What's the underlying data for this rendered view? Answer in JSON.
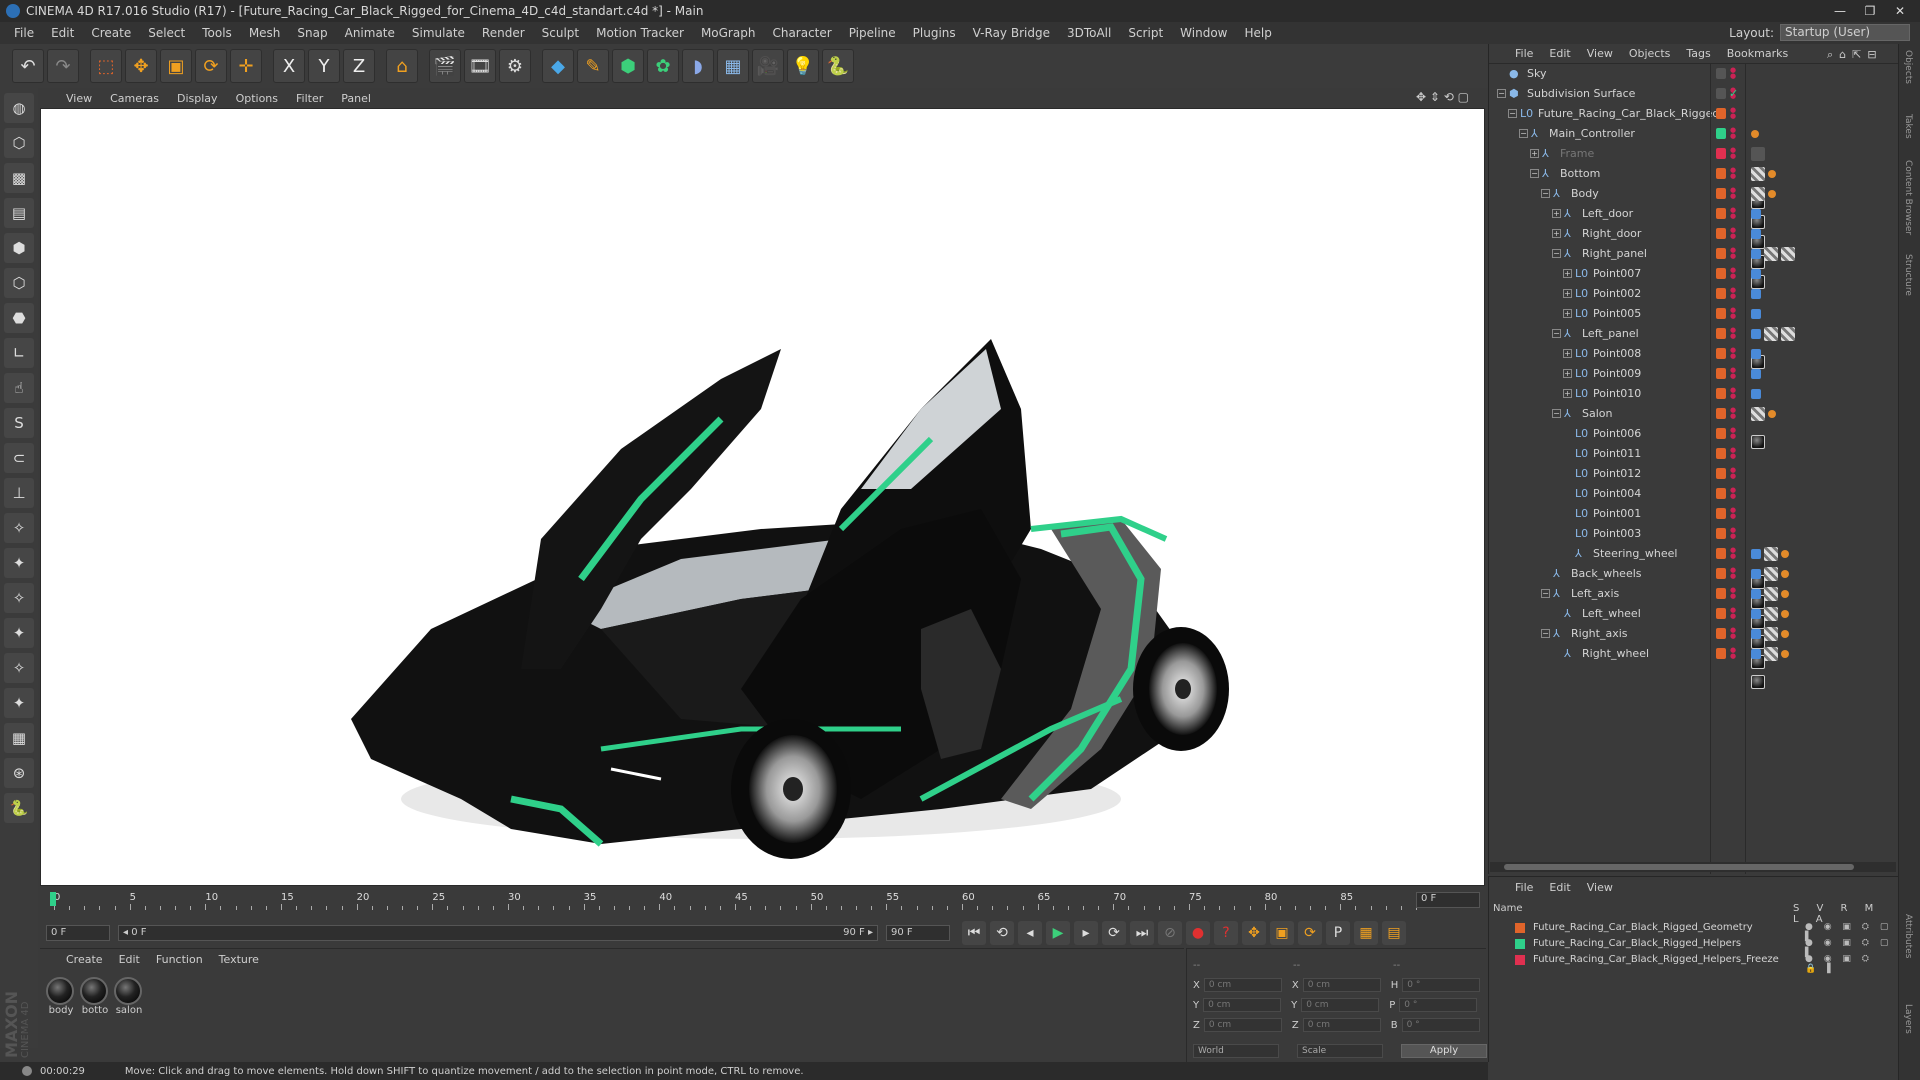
{
  "titlebar": {
    "title": "CINEMA 4D R17.016 Studio (R17) - [Future_Racing_Car_Black_Rigged_for_Cinema_4D_c4d_standart.c4d *] - Main",
    "minimize": "—",
    "restore": "❐",
    "close": "✕"
  },
  "menubar": {
    "items": [
      "File",
      "Edit",
      "Create",
      "Select",
      "Tools",
      "Mesh",
      "Snap",
      "Animate",
      "Simulate",
      "Render",
      "Sculpt",
      "Motion Tracker",
      "MoGraph",
      "Character",
      "Pipeline",
      "Plugins",
      "V-Ray Bridge",
      "3DToAll",
      "Script",
      "Window",
      "Help"
    ],
    "layout_label": "Layout:",
    "layout_value": "Startup (User)"
  },
  "toolbar": {
    "tools": [
      {
        "name": "undo-icon",
        "glyph": "↶",
        "color": "#dddddd"
      },
      {
        "name": "redo-icon",
        "glyph": "↷",
        "color": "#888888"
      },
      {
        "name": "live-select-icon",
        "glyph": "⬚",
        "color": "#e0642a"
      },
      {
        "name": "move-icon",
        "glyph": "✥",
        "color": "#f0a020"
      },
      {
        "name": "scale-icon",
        "glyph": "▣",
        "color": "#f0a020"
      },
      {
        "name": "rotate-icon",
        "glyph": "⟳",
        "color": "#f0a020"
      },
      {
        "name": "transform-icon",
        "glyph": "✛",
        "color": "#f0a020"
      },
      {
        "name": "x-axis-icon",
        "glyph": "X",
        "color": "#eeeeee"
      },
      {
        "name": "y-axis-icon",
        "glyph": "Y",
        "color": "#eeeeee"
      },
      {
        "name": "z-axis-icon",
        "glyph": "Z",
        "color": "#eeeeee"
      },
      {
        "name": "world-coords-icon",
        "glyph": "⌂",
        "color": "#f0a020"
      },
      {
        "name": "render-view-icon",
        "glyph": "🎬",
        "color": "#dddddd"
      },
      {
        "name": "render-picture-icon",
        "glyph": "🎞",
        "color": "#dddddd"
      },
      {
        "name": "render-settings-icon",
        "glyph": "⚙",
        "color": "#dddddd"
      },
      {
        "name": "cube-icon",
        "glyph": "◆",
        "color": "#4aa8e8"
      },
      {
        "name": "pen-icon",
        "glyph": "✎",
        "color": "#f0a020"
      },
      {
        "name": "subdivision-icon",
        "glyph": "⬢",
        "color": "#3ccf7a"
      },
      {
        "name": "cloner-icon",
        "glyph": "✿",
        "color": "#3ccf7a"
      },
      {
        "name": "deformer-icon",
        "glyph": "◗",
        "color": "#8aa8e8"
      },
      {
        "name": "floor-icon",
        "glyph": "▦",
        "color": "#8ab8e8"
      },
      {
        "name": "camera-icon",
        "glyph": "🎥",
        "color": "#dddddd"
      },
      {
        "name": "light-icon",
        "glyph": "💡",
        "color": "#dddddd"
      },
      {
        "name": "python-icon",
        "glyph": "🐍",
        "color": "#4a8ad8"
      }
    ]
  },
  "lefttools": [
    {
      "name": "sculpt-mode-icon",
      "glyph": "◍"
    },
    {
      "name": "model-mode-icon",
      "glyph": "⬡"
    },
    {
      "name": "texture-mode-icon",
      "glyph": "▩"
    },
    {
      "name": "workplane-icon",
      "glyph": "▤"
    },
    {
      "name": "points-mode-icon",
      "glyph": "⬢"
    },
    {
      "name": "edges-mode-icon",
      "glyph": "⬡"
    },
    {
      "name": "polygons-mode-icon",
      "glyph": "⬣"
    },
    {
      "name": "axis-mode-icon",
      "glyph": "∟"
    },
    {
      "name": "tweak-icon",
      "glyph": "☝"
    },
    {
      "name": "snap-icon",
      "glyph": "S"
    },
    {
      "name": "magnet-icon",
      "glyph": "⊂"
    },
    {
      "name": "axis-lock-icon",
      "glyph": "⊥"
    },
    {
      "name": "brush-1-icon",
      "glyph": "✧"
    },
    {
      "name": "brush-2-icon",
      "glyph": "✦"
    },
    {
      "name": "brush-3-icon",
      "glyph": "✧"
    },
    {
      "name": "brush-4-icon",
      "glyph": "✦"
    },
    {
      "name": "brush-5-icon",
      "glyph": "✧"
    },
    {
      "name": "brush-6-icon",
      "glyph": "✦"
    },
    {
      "name": "grid-lock-icon",
      "glyph": "▦"
    },
    {
      "name": "workplane-lock-icon",
      "glyph": "⊛"
    },
    {
      "name": "python-icon",
      "glyph": "🐍"
    }
  ],
  "viewport": {
    "menu": [
      "View",
      "Cameras",
      "Display",
      "Options",
      "Filter",
      "Panel"
    ],
    "nav_icons": "✥ ⇕ ⟲ ▢"
  },
  "timeline": {
    "ticks": [
      "0",
      "5",
      "10",
      "15",
      "20",
      "25",
      "30",
      "35",
      "40",
      "45",
      "50",
      "55",
      "60",
      "65",
      "70",
      "75",
      "80",
      "85",
      "90"
    ],
    "current_frame": "0 F",
    "start_field": "0 F",
    "range_start": "◂ 0 F",
    "range_end": "90 F ▸",
    "end_field": "90 F"
  },
  "transport": {
    "buttons": [
      {
        "name": "goto-start-icon",
        "glyph": "⏮",
        "color": "#dddddd"
      },
      {
        "name": "prev-key-icon",
        "glyph": "⟲",
        "color": "#dddddd"
      },
      {
        "name": "prev-frame-icon",
        "glyph": "◂",
        "color": "#dddddd"
      },
      {
        "name": "play-icon",
        "glyph": "▶",
        "color": "#3ccf7a"
      },
      {
        "name": "next-frame-icon",
        "glyph": "▸",
        "color": "#dddddd"
      },
      {
        "name": "next-key-icon",
        "glyph": "⟳",
        "color": "#dddddd"
      },
      {
        "name": "goto-end-icon",
        "glyph": "⏭",
        "color": "#dddddd"
      },
      {
        "name": "record-disabled-icon",
        "glyph": "⊘",
        "color": "#777777"
      },
      {
        "name": "record-keys-icon",
        "glyph": "●",
        "color": "#e03030"
      },
      {
        "name": "auto-key-icon",
        "glyph": "?",
        "color": "#e03030"
      },
      {
        "name": "key-pos-icon",
        "glyph": "✥",
        "color": "#f0a020"
      },
      {
        "name": "key-scale-icon",
        "glyph": "▣",
        "color": "#f0a020"
      },
      {
        "name": "key-rot-icon",
        "glyph": "⟳",
        "color": "#f0a020"
      },
      {
        "name": "key-param-icon",
        "glyph": "P",
        "color": "#dddddd"
      },
      {
        "name": "key-pla-icon",
        "glyph": "▦",
        "color": "#f0a020"
      },
      {
        "name": "timeline-icon",
        "glyph": "▤",
        "color": "#f0a020"
      }
    ]
  },
  "materials": {
    "menu": [
      "Create",
      "Edit",
      "Function",
      "Texture"
    ],
    "items": [
      "body",
      "botto",
      "salon"
    ]
  },
  "coordinates": {
    "rows": [
      {
        "a": "X",
        "av": "0 cm",
        "b": "X",
        "bv": "0 cm",
        "c": "H",
        "cv": "0 °"
      },
      {
        "a": "Y",
        "av": "0 cm",
        "b": "Y",
        "bv": "0 cm",
        "c": "P",
        "cv": "0 °"
      },
      {
        "a": "Z",
        "av": "0 cm",
        "b": "Z",
        "bv": "0 cm",
        "c": "B",
        "cv": "0 °"
      }
    ],
    "header_left": "--",
    "header_mid": "--",
    "header_right": "--",
    "mode_world": "World",
    "mode_scale": "Scale",
    "apply": "Apply"
  },
  "statusbar": {
    "time": "00:00:29",
    "message": "Move: Click and drag to move elements. Hold down SHIFT to quantize movement / add to the selection in point mode, CTRL to remove."
  },
  "brand": {
    "maxon": "MAXON",
    "cinema": "CINEMA 4D"
  },
  "objects": {
    "menu": [
      "File",
      "Edit",
      "View",
      "Objects",
      "Tags",
      "Bookmarks"
    ],
    "rows": [
      {
        "label": "Sky",
        "indent": 0,
        "exp": "",
        "icon": "●",
        "swatch": "#555555",
        "tags": ""
      },
      {
        "label": "Subdivision Surface",
        "indent": 0,
        "exp": "−",
        "icon": "⬢",
        "swatch": "#555555",
        "tags": "✓"
      },
      {
        "label": "Future_Racing_Car_Black_Rigged",
        "indent": 1,
        "exp": "−",
        "icon": "L0",
        "swatch": "#e0642a",
        "tags": ""
      },
      {
        "label": "Main_Controller",
        "indent": 2,
        "exp": "−",
        "icon": "⅄",
        "swatch": "#2fd08a",
        "tags": "o"
      },
      {
        "label": "Frame",
        "indent": 3,
        "exp": "+",
        "icon": "⅄",
        "swatch": "#e03050",
        "tags": "g"
      },
      {
        "label": "Bottom",
        "indent": 3,
        "exp": "−",
        "icon": "⅄",
        "swatch": "#e0642a",
        "tags": "mco"
      },
      {
        "label": "Body",
        "indent": 4,
        "exp": "−",
        "icon": "⅄",
        "swatch": "#e0642a",
        "tags": "mco"
      },
      {
        "label": "Left_door",
        "indent": 5,
        "exp": "+",
        "icon": "⅄",
        "swatch": "#e0642a",
        "tags": "bm"
      },
      {
        "label": "Right_door",
        "indent": 5,
        "exp": "+",
        "icon": "⅄",
        "swatch": "#e0642a",
        "tags": "bm"
      },
      {
        "label": "Right_panel",
        "indent": 5,
        "exp": "−",
        "icon": "⅄",
        "swatch": "#e0642a",
        "tags": "bmcc"
      },
      {
        "label": "Point007",
        "indent": 6,
        "exp": "+",
        "icon": "L0",
        "swatch": "#e0642a",
        "tags": "v"
      },
      {
        "label": "Point002",
        "indent": 6,
        "exp": "+",
        "icon": "L0",
        "swatch": "#e0642a",
        "tags": "v"
      },
      {
        "label": "Point005",
        "indent": 6,
        "exp": "+",
        "icon": "L0",
        "swatch": "#e0642a",
        "tags": "v"
      },
      {
        "label": "Left_panel",
        "indent": 5,
        "exp": "−",
        "icon": "⅄",
        "swatch": "#e0642a",
        "tags": "bmcc"
      },
      {
        "label": "Point008",
        "indent": 6,
        "exp": "+",
        "icon": "L0",
        "swatch": "#e0642a",
        "tags": "v"
      },
      {
        "label": "Point009",
        "indent": 6,
        "exp": "+",
        "icon": "L0",
        "swatch": "#e0642a",
        "tags": "v"
      },
      {
        "label": "Point010",
        "indent": 6,
        "exp": "+",
        "icon": "L0",
        "swatch": "#e0642a",
        "tags": "v"
      },
      {
        "label": "Salon",
        "indent": 5,
        "exp": "−",
        "icon": "⅄",
        "swatch": "#e0642a",
        "tags": "mco"
      },
      {
        "label": "Point006",
        "indent": 6,
        "exp": "",
        "icon": "L0",
        "swatch": "#e0642a",
        "tags": ""
      },
      {
        "label": "Point011",
        "indent": 6,
        "exp": "",
        "icon": "L0",
        "swatch": "#e0642a",
        "tags": ""
      },
      {
        "label": "Point012",
        "indent": 6,
        "exp": "",
        "icon": "L0",
        "swatch": "#e0642a",
        "tags": ""
      },
      {
        "label": "Point004",
        "indent": 6,
        "exp": "",
        "icon": "L0",
        "swatch": "#e0642a",
        "tags": ""
      },
      {
        "label": "Point001",
        "indent": 6,
        "exp": "",
        "icon": "L0",
        "swatch": "#e0642a",
        "tags": ""
      },
      {
        "label": "Point003",
        "indent": 6,
        "exp": "",
        "icon": "L0",
        "swatch": "#e0642a",
        "tags": ""
      },
      {
        "label": "Steering_wheel",
        "indent": 6,
        "exp": "",
        "icon": "⅄",
        "swatch": "#e0642a",
        "tags": "bmco"
      },
      {
        "label": "Back_wheels",
        "indent": 4,
        "exp": "",
        "icon": "⅄",
        "swatch": "#e0642a",
        "tags": "bmco"
      },
      {
        "label": "Left_axis",
        "indent": 4,
        "exp": "−",
        "icon": "⅄",
        "swatch": "#e0642a",
        "tags": "bmco"
      },
      {
        "label": "Left_wheel",
        "indent": 5,
        "exp": "",
        "icon": "⅄",
        "swatch": "#e0642a",
        "tags": "bmco"
      },
      {
        "label": "Right_axis",
        "indent": 4,
        "exp": "−",
        "icon": "⅄",
        "swatch": "#e0642a",
        "tags": "bmco"
      },
      {
        "label": "Right_wheel",
        "indent": 5,
        "exp": "",
        "icon": "⅄",
        "swatch": "#e0642a",
        "tags": "bmco"
      }
    ]
  },
  "sidetabs": [
    "Objects",
    "Takes",
    "Content Browser",
    "Structure",
    "Attributes",
    "Layers"
  ],
  "layers": {
    "menu": [
      "File",
      "Edit",
      "View"
    ],
    "header": {
      "name": "Name",
      "cols": "S V R M L A"
    },
    "rows": [
      {
        "label": "Future_Racing_Car_Black_Rigged_Geometry",
        "color": "#e0642a",
        "icons": "● ◉ ▣ ⛭ ▢ ▌"
      },
      {
        "label": "Future_Racing_Car_Black_Rigged_Helpers",
        "color": "#2fd08a",
        "icons": "● ◉ ▣ ⛭ ▢ ▌"
      },
      {
        "label": "Future_Racing_Car_Black_Rigged_Helpers_Freeze",
        "color": "#e03050",
        "icons": "● ◉ ▣ ⛭ 🔒 ▌"
      }
    ]
  }
}
